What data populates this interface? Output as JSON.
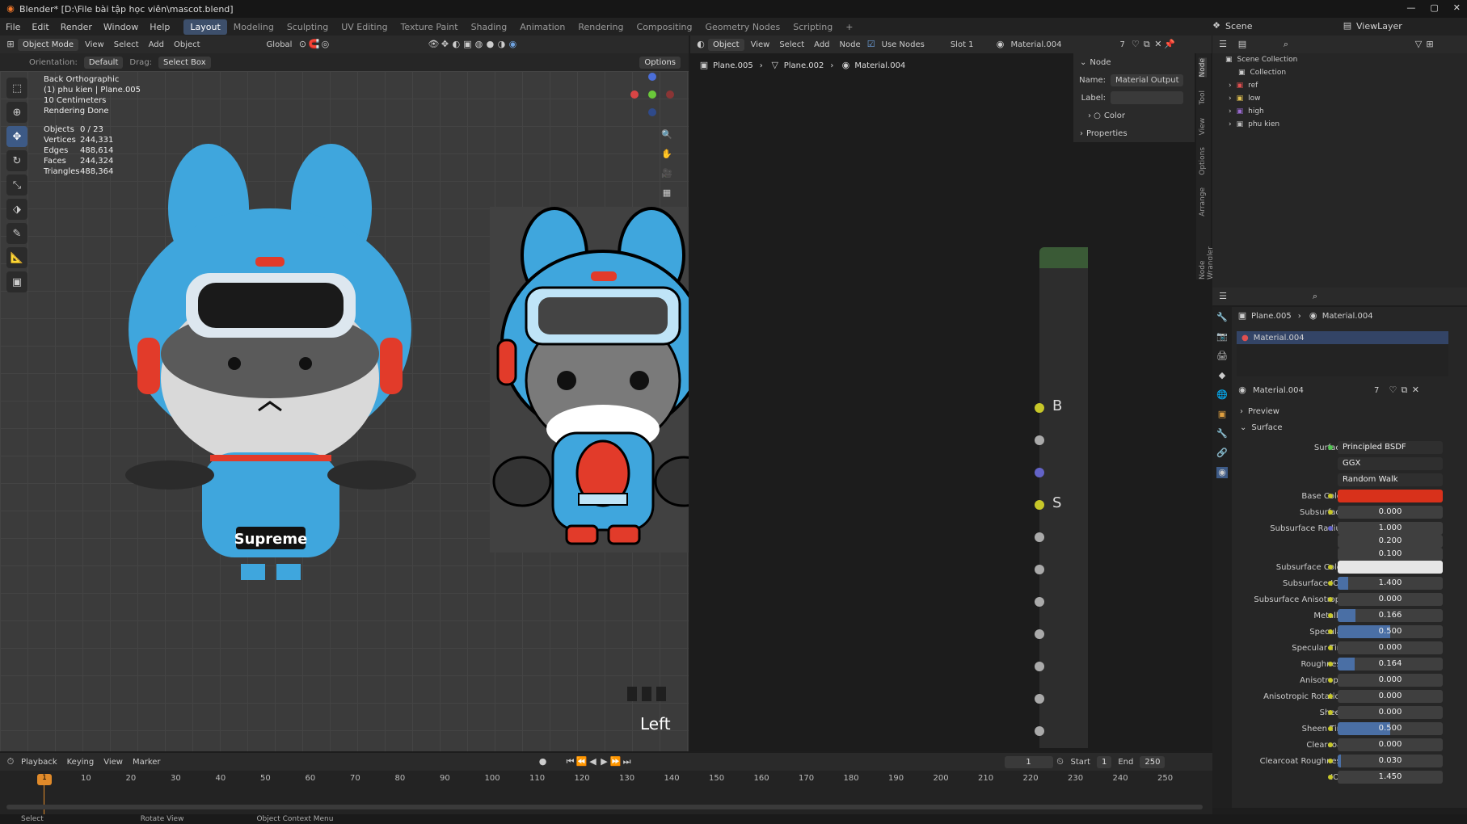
{
  "title": "Blender* [D:\\File bài tập học viên\\mascot.blend]",
  "menu": [
    "File",
    "Edit",
    "Render",
    "Window",
    "Help"
  ],
  "workspaces": [
    "Layout",
    "Modeling",
    "Sculpting",
    "UV Editing",
    "Texture Paint",
    "Shading",
    "Animation",
    "Rendering",
    "Compositing",
    "Geometry Nodes",
    "Scripting"
  ],
  "viewport_header": {
    "mode": "Object Mode",
    "menus": [
      "View",
      "Select",
      "Add",
      "Object"
    ],
    "transform": "Global",
    "orientation_label": "Orientation:",
    "orientation": "Default",
    "drag_label": "Drag:",
    "drag": "Select Box",
    "options": "Options"
  },
  "viewport_overlay": {
    "view": "Back Orthographic",
    "object": "(1) phu kien | Plane.005",
    "scale": "10 Centimeters",
    "render": "Rendering Done",
    "stats": [
      {
        "label": "Objects",
        "value": "0 / 23"
      },
      {
        "label": "Vertices",
        "value": "244,331"
      },
      {
        "label": "Edges",
        "value": "488,614"
      },
      {
        "label": "Faces",
        "value": "244,324"
      },
      {
        "label": "Triangles",
        "value": "488,364"
      }
    ],
    "mascot_text": "Supreme",
    "corner_label": "Left"
  },
  "node_header": {
    "object": "Object",
    "menus": [
      "View",
      "Select",
      "Add",
      "Node"
    ],
    "use_nodes": "Use Nodes",
    "slot": "Slot 1",
    "material": "Material.004",
    "users": "7"
  },
  "breadcrumb": [
    "Plane.005",
    "Plane.002",
    "Material.004"
  ],
  "node_panel": {
    "section": "Node",
    "name_label": "Name:",
    "name_value": "Material Output",
    "label_label": "Label:",
    "color": "Color",
    "properties": "Properties"
  },
  "node_sockets_labels": [
    "B",
    "S"
  ],
  "side_tabs": [
    "Node",
    "Tool",
    "View",
    "Options",
    "Arrange",
    "Node Wrangler"
  ],
  "outliner": {
    "scene": "Scene",
    "viewlayer": "ViewLayer",
    "root": "Scene Collection",
    "items": [
      "Collection",
      "ref",
      "low",
      "high",
      "phu kien"
    ]
  },
  "props": {
    "breadcrumb": [
      "Plane.005",
      "Material.004"
    ],
    "slot_material": "Material.004",
    "material_name": "Material.004",
    "users": "7",
    "preview": "Preview",
    "surface_section": "Surface",
    "surface_label": "Surface",
    "surface_value": "Principled BSDF",
    "distribution": "GGX",
    "subsurface_method": "Random Walk",
    "base_color_label": "Base Color",
    "base_color": "#d8311b",
    "fields": [
      {
        "label": "Subsurface",
        "value": "0.000",
        "fill": 0
      },
      {
        "label": "Subsurface Radius",
        "value": "1.000",
        "fill": 0
      },
      {
        "label": "",
        "value": "0.200",
        "fill": 0
      },
      {
        "label": "",
        "value": "0.100",
        "fill": 0
      },
      {
        "label": "Subsurface Color",
        "value": "",
        "fill": 0
      },
      {
        "label": "Subsurface IOR",
        "value": "1.400",
        "fill": 0.1
      },
      {
        "label": "Subsurface Anisotropy",
        "value": "0.000",
        "fill": 0
      },
      {
        "label": "Metallic",
        "value": "0.166",
        "fill": 0.166
      },
      {
        "label": "Specular",
        "value": "0.500",
        "fill": 0.5
      },
      {
        "label": "Specular Tint",
        "value": "0.000",
        "fill": 0
      },
      {
        "label": "Roughness",
        "value": "0.164",
        "fill": 0.164
      },
      {
        "label": "Anisotropic",
        "value": "0.000",
        "fill": 0
      },
      {
        "label": "Anisotropic Rotation",
        "value": "0.000",
        "fill": 0
      },
      {
        "label": "Sheen",
        "value": "0.000",
        "fill": 0
      },
      {
        "label": "Sheen Tint",
        "value": "0.500",
        "fill": 0.5
      },
      {
        "label": "Clearcoat",
        "value": "0.000",
        "fill": 0
      },
      {
        "label": "Clearcoat Roughness",
        "value": "0.030",
        "fill": 0.03
      },
      {
        "label": "IOR",
        "value": "1.450",
        "fill": 0
      }
    ]
  },
  "timeline": {
    "menus": [
      "Playback",
      "Keying",
      "View",
      "Marker"
    ],
    "current": "1",
    "start_label": "Start",
    "start": "1",
    "end_label": "End",
    "end": "250",
    "ticks": [
      "10",
      "20",
      "30",
      "40",
      "50",
      "60",
      "70",
      "80",
      "90",
      "100",
      "110",
      "120",
      "130",
      "140",
      "150",
      "160",
      "170",
      "180",
      "190",
      "200",
      "210",
      "220",
      "230",
      "240",
      "250"
    ],
    "playhead": "1"
  },
  "statusbar": {
    "left": "Select",
    "middle": "Rotate View",
    "right": "Object Context Menu"
  },
  "colors": {
    "accent": "#3d5a86",
    "mascot_blue": "#3fa6dd",
    "mascot_red": "#e23b2a"
  }
}
